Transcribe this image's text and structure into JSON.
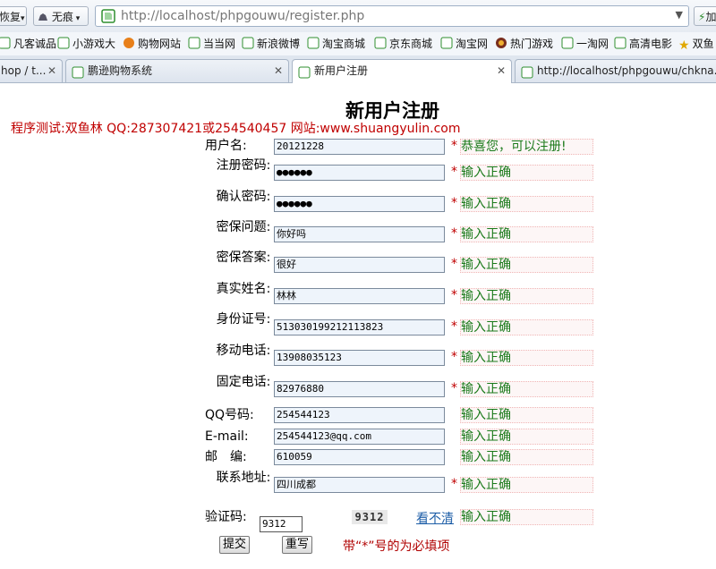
{
  "browser": {
    "restore_label": "恢复",
    "mode_label": "无痕",
    "address_url": "http://localhost/phpgouwu/register.php",
    "addon_label": "加",
    "bookmarks": [
      "凡客诚品",
      "小游戏大",
      "购物网站",
      "当当网",
      "新浪微博",
      "淘宝商城",
      "京东商城",
      "淘宝网",
      "热门游戏",
      "一淘网",
      "高清电影",
      "双鱼"
    ],
    "tabs": [
      {
        "label": "hop / t..."
      },
      {
        "label": "鹏逊购物系统"
      },
      {
        "label": "新用户注册",
        "active": true
      },
      {
        "label": "http://localhost/phpgouwu/chkna..."
      }
    ],
    "close_glyph": "✕"
  },
  "page": {
    "title": "新用户注册",
    "credit": "程序测试:双鱼林 QQ:287307421或254540457 网站:www.shuangyulin.com",
    "required_mark": "*",
    "fields": [
      {
        "label": "用户名:",
        "value": "20121228",
        "required": true,
        "message": "恭喜您，可以注册!"
      },
      {
        "label": "注册密码:",
        "value": "●●●●●●",
        "required": true,
        "message": "输入正确"
      },
      {
        "label": "确认密码:",
        "value": "●●●●●●",
        "required": true,
        "message": "输入正确"
      },
      {
        "label": "密保问题:",
        "value": "你好吗",
        "required": true,
        "message": "输入正确"
      },
      {
        "label": "密保答案:",
        "value": "很好",
        "required": true,
        "message": "输入正确"
      },
      {
        "label": "真实姓名:",
        "value": "林林",
        "required": true,
        "message": "输入正确"
      },
      {
        "label": "身份证号:",
        "value": "513030199212113823",
        "required": true,
        "message": "输入正确"
      },
      {
        "label": "移动电话:",
        "value": "13908035123",
        "required": true,
        "message": "输入正确"
      },
      {
        "label": "固定电话:",
        "value": "82976880",
        "required": true,
        "message": "输入正确"
      },
      {
        "label": "QQ号码:",
        "value": "254544123",
        "required": false,
        "message": "输入正确"
      },
      {
        "label": "E-mail:",
        "value": "254544123@qq.com",
        "required": false,
        "message": "输入正确"
      },
      {
        "label": "邮　编:",
        "value": "610059",
        "required": false,
        "message": "输入正确"
      },
      {
        "label": "联系地址:",
        "value": "四川成都",
        "required": true,
        "message": "输入正确"
      }
    ],
    "captcha": {
      "label": "验证码:",
      "value": "9312",
      "image_text": "9312",
      "refresh_link": "看不清",
      "message": "输入正确"
    },
    "submit_label": "提交",
    "reset_label": "重写",
    "required_note": "带“*”号的为必填项"
  },
  "colors": {
    "credit": "#c00000",
    "success": "#1a7a1a",
    "required": "#c00000",
    "link": "#1f5fa8"
  }
}
